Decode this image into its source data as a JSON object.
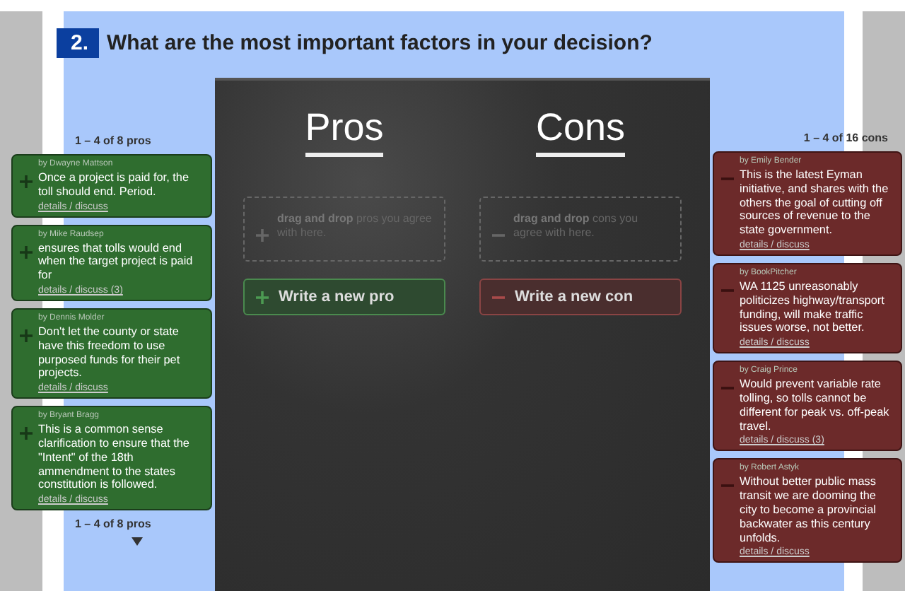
{
  "question": {
    "number": "2.",
    "title": "What are the most important factors in your decision?"
  },
  "pros": {
    "counter_top": "1 – 4 of 8 pros",
    "counter_bottom": "1 – 4 of 8 pros",
    "items": [
      {
        "author": "by Dwayne Mattson",
        "text": "Once a project is paid for, the toll should end. Period.",
        "link": "details / discuss"
      },
      {
        "author": "by Mike Raudsep",
        "text": "ensures that tolls would end when the target project is paid for",
        "link": "details / discuss (3)"
      },
      {
        "author": "by Dennis Molder",
        "text": "Don't let the county or state have this freedom to use purposed funds for their pet projects.",
        "link": "details / discuss"
      },
      {
        "author": "by Bryant Bragg",
        "text": "This is a common sense clarification to ensure that the \"Intent\" of the 18th ammendment to the states constitution is followed.",
        "link": "details / discuss"
      }
    ]
  },
  "board": {
    "columns": [
      {
        "kind": "pro",
        "heading": "Pros",
        "drop_hint": "**drag and drop** pros you agree with here.",
        "write_button": "Write a new pro"
      },
      {
        "kind": "con",
        "heading": "Cons",
        "drop_hint": "**drag and drop** cons you agree with here.",
        "write_button": "Write a new con"
      }
    ]
  },
  "cons": {
    "counter_top": "1 – 4 of 16 cons",
    "items": [
      {
        "author": "by Emily Bender",
        "text": "This is the latest Eyman initiative, and shares with the others the goal of cutting off sources of revenue to the state government.",
        "link": "details / discuss"
      },
      {
        "author": "by BookPitcher",
        "text": "WA 1125 unreasonably politicizes highway/transport funding, will make traffic issues worse, not better.",
        "link": "details / discuss"
      },
      {
        "author": "by Craig Prince",
        "text": "Would prevent variable rate tolling, so tolls cannot be different for peak vs. off-peak travel.",
        "link": "details / discuss (3)"
      },
      {
        "author": "by Robert Astyk",
        "text": "Without better public mass transit we are dooming the city to become a provincial backwater as this century unfolds.",
        "link": "details / discuss"
      }
    ]
  }
}
